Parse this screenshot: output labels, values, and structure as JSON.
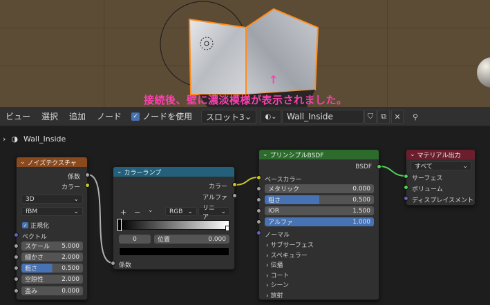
{
  "annotation": "接続後、壁に濃淡模様が表示されました。",
  "header": {
    "menu": [
      "ビュー",
      "選択",
      "追加",
      "ノード"
    ],
    "use_nodes_label": "ノードを使用",
    "slot": "スロット3",
    "material_name": "Wall_Inside"
  },
  "breadcrumb": "Wall_Inside",
  "noise_node": {
    "title": "ノイズテクスチャ",
    "out_fac": "係数",
    "out_color": "カラー",
    "dim": "3D",
    "type": "fBM",
    "normalize": "正規化",
    "vector": "ベクトル",
    "fields": [
      {
        "label": "スケール",
        "value": "5.000"
      },
      {
        "label": "細かさ",
        "value": "2.000"
      },
      {
        "label": "粗さ",
        "value": "0.500"
      },
      {
        "label": "空隙性",
        "value": "2.000"
      },
      {
        "label": "歪み",
        "value": "0.000"
      }
    ]
  },
  "ramp_node": {
    "title": "カラーランプ",
    "out_color": "カラー",
    "out_alpha": "アルファ",
    "plus": "+",
    "minus": "−",
    "color_mode": "RGB",
    "interp": "リニア",
    "index": "0",
    "pos_label": "位置",
    "pos_value": "0.000",
    "in_fac": "係数"
  },
  "bsdf_node": {
    "title": "プリンシプルBSDF",
    "out": "BSDF",
    "base_color": "ベースカラー",
    "fields": [
      {
        "label": "メタリック",
        "value": "0.000",
        "fill": 0.0
      },
      {
        "label": "粗さ",
        "value": "0.500",
        "fill": 0.5
      },
      {
        "label": "IOR",
        "value": "1.500",
        "fill": 0.0
      },
      {
        "label": "アルファ",
        "value": "1.000",
        "fill": 1.0
      }
    ],
    "normal": "ノーマル",
    "panels": [
      "サブサーフェス",
      "スペキュラー",
      "伝播",
      "コート",
      "シーン",
      "放射"
    ]
  },
  "output_node": {
    "title": "マテリアル出力",
    "target": "すべて",
    "surface": "サーフェス",
    "volume": "ボリューム",
    "displacement": "ディスプレイスメント"
  },
  "colors": {
    "noise_header": "#8a4a1e",
    "ramp_header": "#24607c",
    "bsdf_header": "#2c6b2c",
    "output_header": "#6b1f2e",
    "link": "#c8c8c8",
    "link_color": "#c7c729",
    "link_shader": "#4fd25a",
    "selection": "#ff8c1a"
  }
}
